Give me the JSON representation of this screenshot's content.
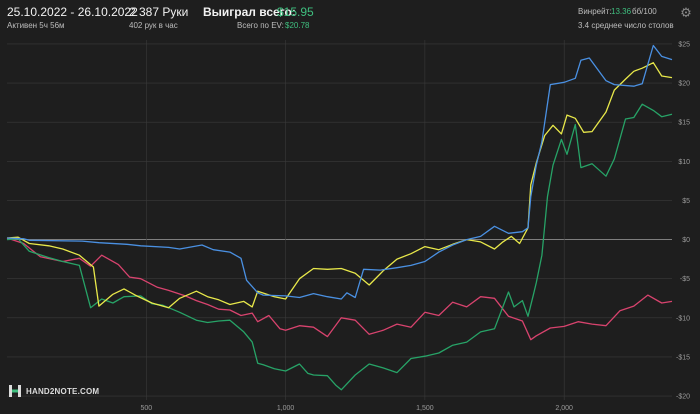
{
  "header": {
    "date_range": "25.10.2022 - 26.10.2022",
    "active": "Активен 5ч 56м",
    "hands": "2 387 Руки",
    "hands_rate": "402 рук в час",
    "won_label": "Выиграл всего:",
    "won_value": "$15.95",
    "ev_label": "Всего по EV:",
    "ev_value": "$20.78",
    "winrate_label": "Винрейт:",
    "winrate_value": "13.36",
    "winrate_unit": "бб/100",
    "avg_tables": "3.4 среднее число столов"
  },
  "logo": {
    "text": "HAND2NOTE.COM"
  },
  "icons": {
    "settings": "gear-icon"
  },
  "colors": {
    "background": "#1e1e1e",
    "grid": "#3a3a3a",
    "zero_line": "#8c8c8c",
    "blue": "#4a90e2",
    "yellow": "#e8e84a",
    "green": "#27a367",
    "red": "#d8436e",
    "accent_green": "#3fbf7f"
  },
  "chart_data": {
    "type": "line",
    "xlim": [
      0,
      2387
    ],
    "ylim": [
      -20.5,
      25.5
    ],
    "x_ticks": [
      500,
      1000,
      1500,
      2000
    ],
    "x_tick_labels": [
      "500",
      "1,000",
      "1,500",
      "2,000"
    ],
    "y_ticks": [
      25,
      20,
      15,
      10,
      5,
      0,
      -5,
      -10,
      -15,
      -20
    ],
    "y_tick_labels": [
      "$25",
      "$20",
      "$15",
      "$10",
      "$5",
      "$0",
      "-$5",
      "-$10",
      "-$15",
      "-$20"
    ],
    "series": [
      {
        "key": "blue",
        "x": [
          0,
          60,
          80,
          270,
          330,
          430,
          480,
          580,
          620,
          700,
          740,
          800,
          840,
          860,
          900,
          920,
          1000,
          1050,
          1100,
          1150,
          1200,
          1220,
          1250,
          1280,
          1340,
          1400,
          1450,
          1500,
          1550,
          1600,
          1650,
          1700,
          1750,
          1800,
          1850,
          1870,
          1880,
          1900,
          1920,
          1950,
          2000,
          2040,
          2060,
          2090,
          2150,
          2180,
          2250,
          2280,
          2320,
          2350,
          2387
        ],
        "y": [
          0.2,
          0.1,
          -0.1,
          -0.2,
          -0.4,
          -0.6,
          -0.8,
          -1.0,
          -1.2,
          -0.7,
          -1.3,
          -1.6,
          -2.4,
          -5.2,
          -6.8,
          -7.1,
          -7.2,
          -7.4,
          -6.9,
          -7.3,
          -7.6,
          -6.8,
          -7.4,
          -3.8,
          -3.9,
          -3.6,
          -3.3,
          -2.8,
          -1.6,
          -0.7,
          0.0,
          0.4,
          1.7,
          0.8,
          1.0,
          1.5,
          5.5,
          9.5,
          12.5,
          19.8,
          20.1,
          20.6,
          22.9,
          23.2,
          20.3,
          19.8,
          19.6,
          19.9,
          24.8,
          23.4,
          23.0
        ]
      },
      {
        "key": "yellow",
        "x": [
          0,
          40,
          80,
          150,
          200,
          260,
          310,
          330,
          380,
          420,
          460,
          520,
          580,
          620,
          680,
          720,
          760,
          800,
          850,
          880,
          900,
          960,
          1000,
          1050,
          1100,
          1150,
          1200,
          1250,
          1300,
          1350,
          1400,
          1450,
          1500,
          1550,
          1600,
          1650,
          1700,
          1750,
          1780,
          1810,
          1840,
          1870,
          1880,
          1900,
          1930,
          1960,
          1990,
          2010,
          2040,
          2070,
          2100,
          2150,
          2180,
          2220,
          2250,
          2280,
          2320,
          2350,
          2387
        ],
        "y": [
          0.2,
          0.3,
          -0.5,
          -0.8,
          -1.2,
          -2.0,
          -3.5,
          -8.5,
          -7.0,
          -6.3,
          -7.1,
          -8.1,
          -8.7,
          -7.5,
          -6.6,
          -7.3,
          -7.7,
          -8.3,
          -7.9,
          -8.6,
          -6.6,
          -7.3,
          -7.6,
          -5.0,
          -3.7,
          -3.8,
          -3.7,
          -4.3,
          -5.8,
          -4.0,
          -2.5,
          -1.8,
          -0.9,
          -1.3,
          -0.6,
          0.0,
          -0.3,
          -1.2,
          -0.3,
          0.4,
          -0.5,
          1.5,
          7.0,
          9.8,
          13.3,
          14.6,
          13.5,
          15.9,
          15.5,
          13.7,
          13.8,
          16.3,
          19.1,
          20.5,
          21.5,
          21.9,
          22.6,
          20.9,
          20.7
        ]
      },
      {
        "key": "green",
        "x": [
          0,
          40,
          80,
          150,
          200,
          260,
          300,
          340,
          380,
          420,
          480,
          520,
          560,
          620,
          680,
          720,
          760,
          800,
          850,
          880,
          900,
          920,
          960,
          1000,
          1050,
          1080,
          1100,
          1150,
          1180,
          1200,
          1250,
          1300,
          1350,
          1400,
          1450,
          1500,
          1550,
          1600,
          1650,
          1700,
          1750,
          1800,
          1820,
          1850,
          1870,
          1890,
          1900,
          1920,
          1940,
          1960,
          1990,
          2010,
          2040,
          2060,
          2100,
          2150,
          2180,
          2220,
          2250,
          2280,
          2320,
          2350,
          2387
        ],
        "y": [
          0.0,
          0.1,
          -1.5,
          -2.3,
          -2.8,
          -3.3,
          -8.7,
          -7.6,
          -8.1,
          -7.3,
          -7.2,
          -8.2,
          -8.4,
          -9.3,
          -10.3,
          -10.6,
          -10.4,
          -10.3,
          -11.8,
          -13.1,
          -15.8,
          -16.0,
          -16.5,
          -16.8,
          -15.9,
          -17.1,
          -17.3,
          -17.4,
          -18.6,
          -19.2,
          -17.3,
          -15.9,
          -16.4,
          -17.0,
          -15.2,
          -14.9,
          -14.5,
          -13.5,
          -13.1,
          -11.8,
          -11.4,
          -6.7,
          -8.6,
          -7.8,
          -9.8,
          -7.0,
          -5.5,
          -2.0,
          5.5,
          9.5,
          12.8,
          10.9,
          14.7,
          9.2,
          9.7,
          8.1,
          10.3,
          15.4,
          15.6,
          17.3,
          16.5,
          15.7,
          16.0
        ]
      },
      {
        "key": "red",
        "x": [
          0,
          60,
          120,
          200,
          260,
          300,
          340,
          400,
          440,
          480,
          540,
          580,
          640,
          680,
          720,
          760,
          800,
          840,
          880,
          900,
          940,
          980,
          1000,
          1050,
          1100,
          1150,
          1200,
          1250,
          1300,
          1350,
          1400,
          1450,
          1500,
          1550,
          1600,
          1650,
          1700,
          1750,
          1800,
          1850,
          1880,
          1900,
          1950,
          2000,
          2050,
          2100,
          2150,
          2200,
          2250,
          2300,
          2350,
          2387
        ],
        "y": [
          0.2,
          -0.5,
          -2.2,
          -2.8,
          -2.4,
          -3.4,
          -2.0,
          -3.2,
          -4.8,
          -5.0,
          -6.1,
          -6.5,
          -7.2,
          -7.8,
          -8.3,
          -8.9,
          -9.0,
          -9.7,
          -9.4,
          -10.5,
          -9.7,
          -11.4,
          -11.6,
          -11.0,
          -11.2,
          -12.4,
          -10.0,
          -10.3,
          -12.1,
          -11.6,
          -10.8,
          -11.2,
          -9.3,
          -9.7,
          -8.0,
          -8.6,
          -7.3,
          -7.5,
          -9.8,
          -10.4,
          -12.8,
          -12.3,
          -11.3,
          -11.1,
          -10.5,
          -10.8,
          -11.0,
          -9.1,
          -8.5,
          -7.1,
          -8.1,
          -7.9
        ]
      }
    ]
  }
}
